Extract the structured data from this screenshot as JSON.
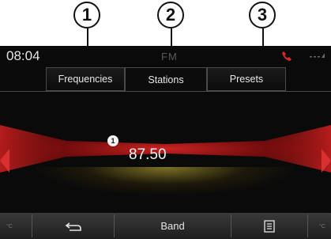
{
  "callouts": [
    "1",
    "2",
    "3"
  ],
  "status": {
    "time": "08:04",
    "source": "FM"
  },
  "tabs": [
    {
      "label": "Frequencies",
      "active": false
    },
    {
      "label": "Stations",
      "active": true
    },
    {
      "label": "Presets",
      "active": false
    }
  ],
  "station": {
    "preset_badge": "1",
    "frequency": "87.50"
  },
  "bottom_bar": {
    "left_label": "°C",
    "right_label": "°C",
    "back_icon": "back-arrow-icon",
    "band_label": "Band",
    "list_icon": "list-icon"
  },
  "colors": {
    "wave": "#e02828",
    "accent_phone": "#d62a2a",
    "floor_glow": "#dcc83c"
  }
}
